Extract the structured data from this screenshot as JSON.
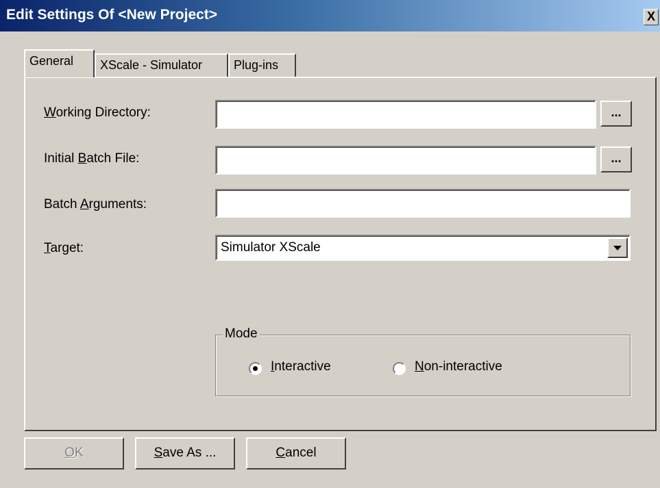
{
  "window": {
    "title": "Edit Settings Of <New Project>",
    "close_label": "X"
  },
  "tabs": [
    {
      "label": "General",
      "active": true
    },
    {
      "label": "XScale - Simulator",
      "active": false
    },
    {
      "label": "Plug-ins",
      "active": false
    }
  ],
  "general": {
    "working_directory": {
      "label_pre": "",
      "label_key": "W",
      "label_post": "orking Directory:",
      "value": ""
    },
    "initial_batch_file": {
      "label_pre": "Initial ",
      "label_key": "B",
      "label_post": "atch File:",
      "value": ""
    },
    "batch_arguments": {
      "label_pre": "Batch ",
      "label_key": "A",
      "label_post": "rguments:",
      "value": ""
    },
    "target": {
      "label_pre": "",
      "label_key": "T",
      "label_post": "arget:",
      "value": "Simulator XScale"
    },
    "browse_label": "...",
    "mode": {
      "legend": "Mode",
      "options": [
        {
          "key": "I",
          "rest": "nteractive",
          "selected": true
        },
        {
          "key": "N",
          "rest": "on-interactive",
          "selected": false
        }
      ]
    }
  },
  "buttons": {
    "ok": {
      "key": "O",
      "rest": "K",
      "enabled": false
    },
    "save_as": {
      "key": "S",
      "rest": "ave As ...",
      "enabled": true
    },
    "cancel": {
      "key": "C",
      "rest": "ancel",
      "enabled": true
    }
  }
}
